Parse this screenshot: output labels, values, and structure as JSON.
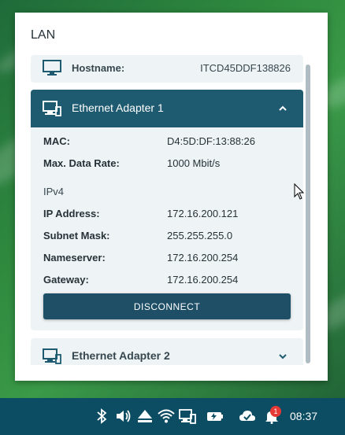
{
  "panel": {
    "title": "LAN",
    "hostname_label": "Hostname:",
    "hostname_value": "ITCD45DDF138826"
  },
  "adapter1": {
    "title": "Ethernet Adapter 1",
    "mac_label": "MAC:",
    "mac_value": "D4:5D:DF:13:88:26",
    "rate_label": "Max. Data Rate:",
    "rate_value": "1000 Mbit/s",
    "ipv4_heading": "IPv4",
    "ip_label": "IP Address:",
    "ip_value": "172.16.200.121",
    "subnet_label": "Subnet Mask:",
    "subnet_value": "255.255.255.0",
    "ns_label": "Nameserver:",
    "ns_value": "172.16.200.254",
    "gw_label": "Gateway:",
    "gw_value": "172.16.200.254",
    "disconnect_label": "DISCONNECT"
  },
  "adapter2": {
    "title": "Ethernet Adapter 2"
  },
  "taskbar": {
    "icons": [
      "bluetooth-icon",
      "volume-icon",
      "eject-icon",
      "wifi-icon",
      "network-icon",
      "battery-icon",
      "cloud-check-icon",
      "notifications-icon"
    ],
    "notification_count": "1",
    "clock": "08:37"
  },
  "colors": {
    "accent": "#1e5b70",
    "button": "#1e4f66",
    "taskbar": "#0c4d63",
    "card_bg": "#eef3f5"
  }
}
